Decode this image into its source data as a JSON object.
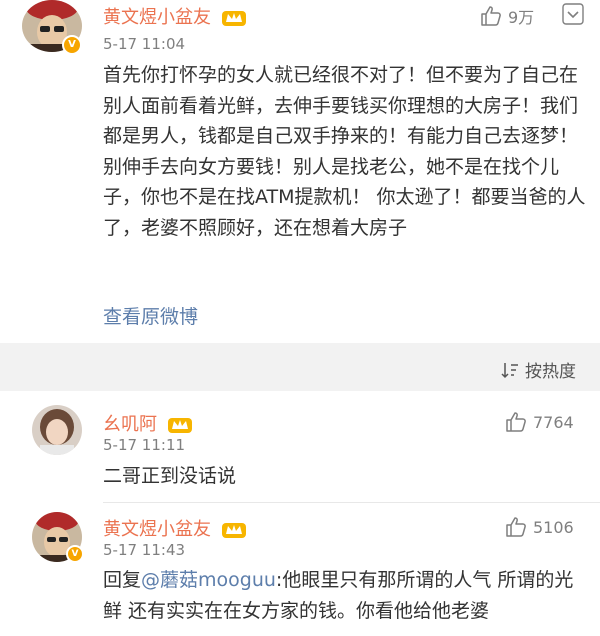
{
  "main_post": {
    "username": "黄文煜小盆友",
    "timestamp": "5-17 11:04",
    "like_count": "9万",
    "content": "首先你打怀孕的女人就已经很不对了！但不要为了自己在别人面前看着光鲜，去伸手要钱买你理想的大房子！我们都是男人，钱都是自己双手挣来的！有能力自己去逐梦！别伸手去向女方要钱！别人是找老公，她不是在找个儿子，你也不是在找ATM提款机！ 你太逊了！都要当爸的人了，老婆不照顾好，还在想着大房子",
    "view_original": "查看原微博"
  },
  "sort": {
    "label": "按热度"
  },
  "comments": [
    {
      "username": "幺叽阿",
      "timestamp": "5-17 11:11",
      "like_count": "7764",
      "content": "二哥正到没话说"
    },
    {
      "username": "黄文煜小盆友",
      "timestamp": "5-17 11:43",
      "like_count": "5106",
      "reply_prefix": "回复",
      "mention": "@蘑菇mooguu",
      "content": ":他眼里只有那所谓的人气 所谓的光鲜 还有实实在在女方家的钱。你看他给他老婆"
    }
  ],
  "colors": {
    "username": "#eb7350",
    "link": "#5d7eab",
    "meta": "#7f7f7f",
    "text": "#333333",
    "band": "#f2f2f2"
  }
}
